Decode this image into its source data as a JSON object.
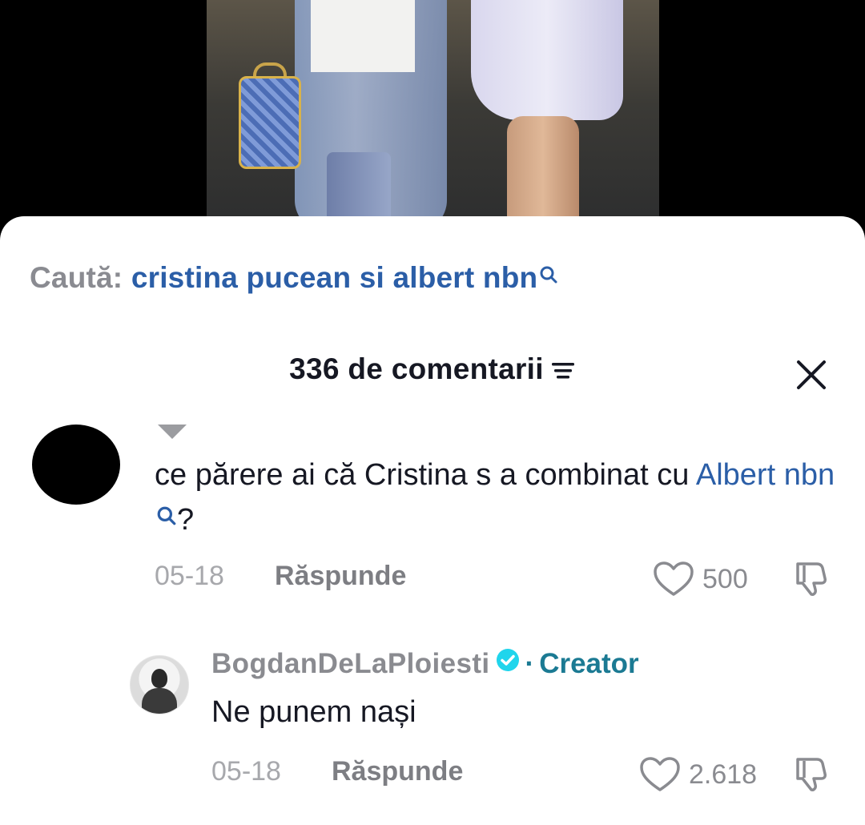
{
  "search": {
    "label": "Caută:",
    "query": "cristina pucean si albert nbn"
  },
  "comments_header": {
    "count_label": "336 de comentarii"
  },
  "comments": [
    {
      "text_before": "ce părere ai că Cristina s a combinat cu ",
      "hashtag": "Albert nbn",
      "text_after": "?",
      "date": "05-18",
      "reply_label": "Răspunde",
      "likes": "500"
    }
  ],
  "replies": [
    {
      "username": "BogdanDeLaPloiesti",
      "separator": "·",
      "tag": "Creator",
      "text": "Ne punem nași",
      "date": "05-18",
      "reply_label": "Răspunde",
      "likes": "2.618"
    }
  ],
  "colors": {
    "link_blue": "#2b5ea7",
    "creator_teal": "#1b7a93",
    "verified_teal": "#20d5ec",
    "text_dark": "#161823",
    "text_gray": "#8a8b90"
  }
}
